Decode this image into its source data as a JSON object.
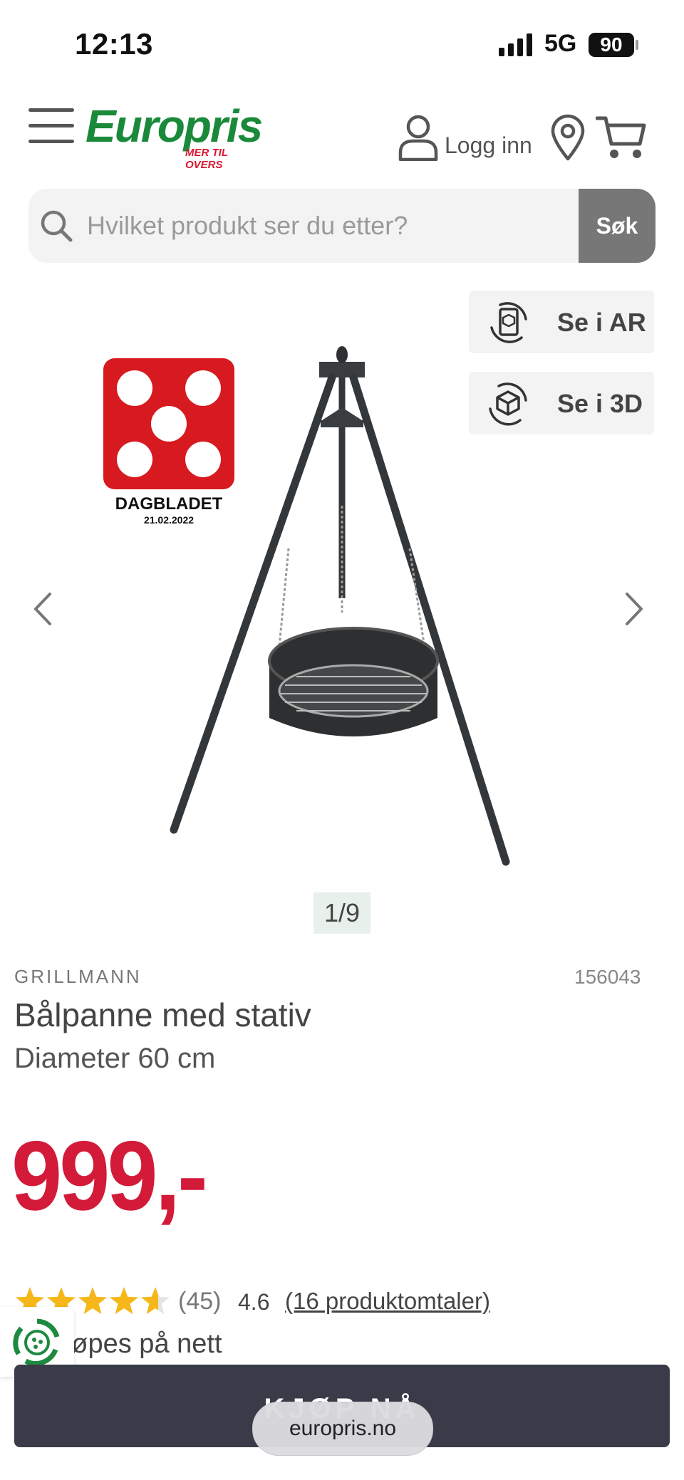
{
  "status_bar": {
    "time": "12:13",
    "network": "5G",
    "battery": "90"
  },
  "header": {
    "logo_text": "Europris",
    "logo_tagline": "MER TIL OVERS",
    "login_label": "Logg inn",
    "icons": [
      "menu-icon",
      "user-icon",
      "location-pin-icon",
      "cart-icon"
    ]
  },
  "search": {
    "placeholder": "Hvilket produkt ser du etter?",
    "button_label": "Søk"
  },
  "gallery": {
    "ar_label": "Se i AR",
    "view3d_label": "Se i 3D",
    "award_name": "DAGBLADET",
    "award_date": "21.02.2022",
    "counter": "1/9"
  },
  "product": {
    "brand": "GRILLMANN",
    "sku": "156043",
    "title": "Bålpanne med stativ",
    "subtitle": "Diameter 60 cm",
    "price": "999,-",
    "rating_count": "(45)",
    "rating_value": "4.6",
    "rating_fraction": 0.92,
    "reviews_link": "(16 produktomtaler)",
    "availability": "an kjøpes på nett"
  },
  "cta": {
    "buy_label": "KJØP NÅ"
  },
  "browser": {
    "url": "europris.no"
  },
  "colors": {
    "brand_green": "#1a8a3a",
    "price_red": "#d31a38",
    "star": "#f5b719",
    "buy_bg": "#3a3b49"
  }
}
